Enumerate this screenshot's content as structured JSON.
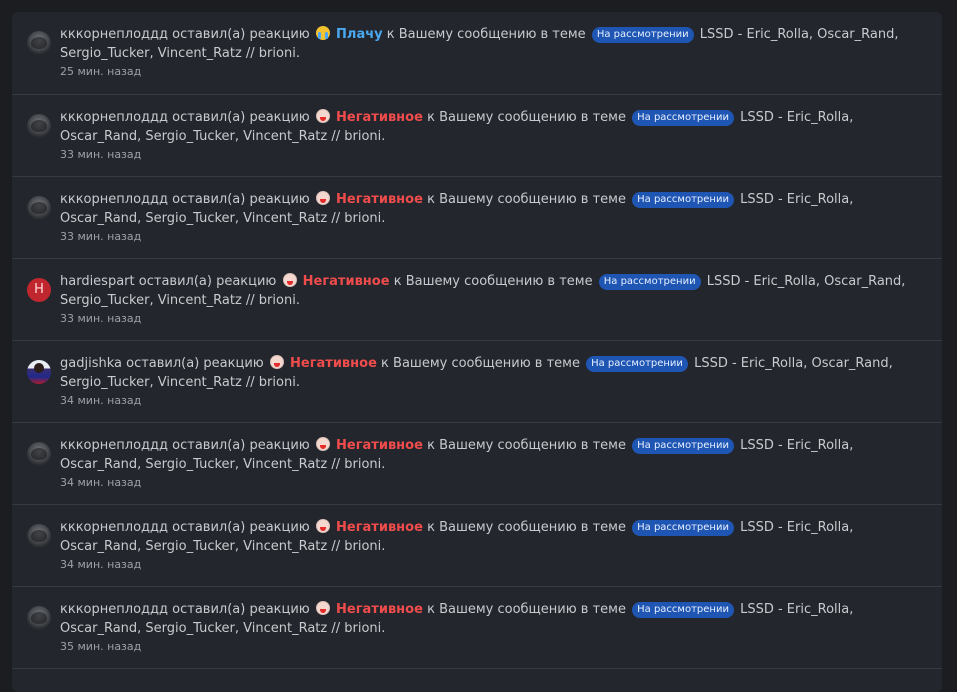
{
  "alerts": [
    {
      "user": "кккорнеплоддд",
      "avatar": "dark",
      "action": "оставил(а) реакцию",
      "reaction_type": "cry",
      "reaction": "Плачу",
      "preposition": "к",
      "link_text": "Вашему сообщению в теме",
      "badge": "На рассмотрении",
      "thread": "LSSD - Eric_Rolla, Oscar_Rand, Sergio_Tucker, Vincent_Ratz // brioni.",
      "time": "25 мин. назад"
    },
    {
      "user": "кккорнеплоддд",
      "avatar": "dark",
      "action": "оставил(а) реакцию",
      "reaction_type": "neg",
      "reaction": "Негативное",
      "preposition": "к",
      "link_text": "Вашему сообщению в теме",
      "badge": "На рассмотрении",
      "thread": "LSSD - Eric_Rolla, Oscar_Rand, Sergio_Tucker, Vincent_Ratz // brioni.",
      "time": "33 мин. назад"
    },
    {
      "user": "кккорнеплоддд",
      "avatar": "dark",
      "action": "оставил(а) реакцию",
      "reaction_type": "neg",
      "reaction": "Негативное",
      "preposition": "к",
      "link_text": "Вашему сообщению в теме",
      "badge": "На рассмотрении",
      "thread": "LSSD - Eric_Rolla, Oscar_Rand, Sergio_Tucker, Vincent_Ratz // brioni.",
      "time": "33 мин. назад"
    },
    {
      "user": "hardiespart",
      "avatar": "letter",
      "avatar_letter": "H",
      "action": "оставил(а) реакцию",
      "reaction_type": "neg",
      "reaction": "Негативное",
      "preposition": "к",
      "link_text": "Вашему сообщению в теме",
      "badge": "На рассмотрении",
      "thread": "LSSD - Eric_Rolla, Oscar_Rand, Sergio_Tucker, Vincent_Ratz // brioni.",
      "time": "33 мин. назад"
    },
    {
      "user": "gadjishka",
      "avatar": "photo",
      "action": "оставил(а) реакцию",
      "reaction_type": "neg",
      "reaction": "Негативное",
      "preposition": "к",
      "link_text": "Вашему сообщению в теме",
      "badge": "На рассмотрении",
      "thread": "LSSD - Eric_Rolla, Oscar_Rand, Sergio_Tucker, Vincent_Ratz // brioni.",
      "time": "34 мин. назад"
    },
    {
      "user": "кккорнеплоддд",
      "avatar": "dark",
      "action": "оставил(а) реакцию",
      "reaction_type": "neg",
      "reaction": "Негативное",
      "preposition": "к",
      "link_text": "Вашему сообщению в теме",
      "badge": "На рассмотрении",
      "thread": "LSSD - Eric_Rolla, Oscar_Rand, Sergio_Tucker, Vincent_Ratz // brioni.",
      "time": "34 мин. назад"
    },
    {
      "user": "кккорнеплоддд",
      "avatar": "dark",
      "action": "оставил(а) реакцию",
      "reaction_type": "neg",
      "reaction": "Негативное",
      "preposition": "к",
      "link_text": "Вашему сообщению в теме",
      "badge": "На рассмотрении",
      "thread": "LSSD - Eric_Rolla, Oscar_Rand, Sergio_Tucker, Vincent_Ratz // brioni.",
      "time": "34 мин. назад"
    },
    {
      "user": "кккорнеплоддд",
      "avatar": "dark",
      "action": "оставил(а) реакцию",
      "reaction_type": "neg",
      "reaction": "Негативное",
      "preposition": "к",
      "link_text": "Вашему сообщению в теме",
      "badge": "На рассмотрении",
      "thread": "LSSD - Eric_Rolla, Oscar_Rand, Sergio_Tucker, Vincent_Ratz // brioni.",
      "time": "35 мин. назад"
    }
  ],
  "colors": {
    "panel": "#23262d",
    "badge": "#1f56b3",
    "negative": "#f04c4c",
    "cry": "#4aa8f0"
  }
}
